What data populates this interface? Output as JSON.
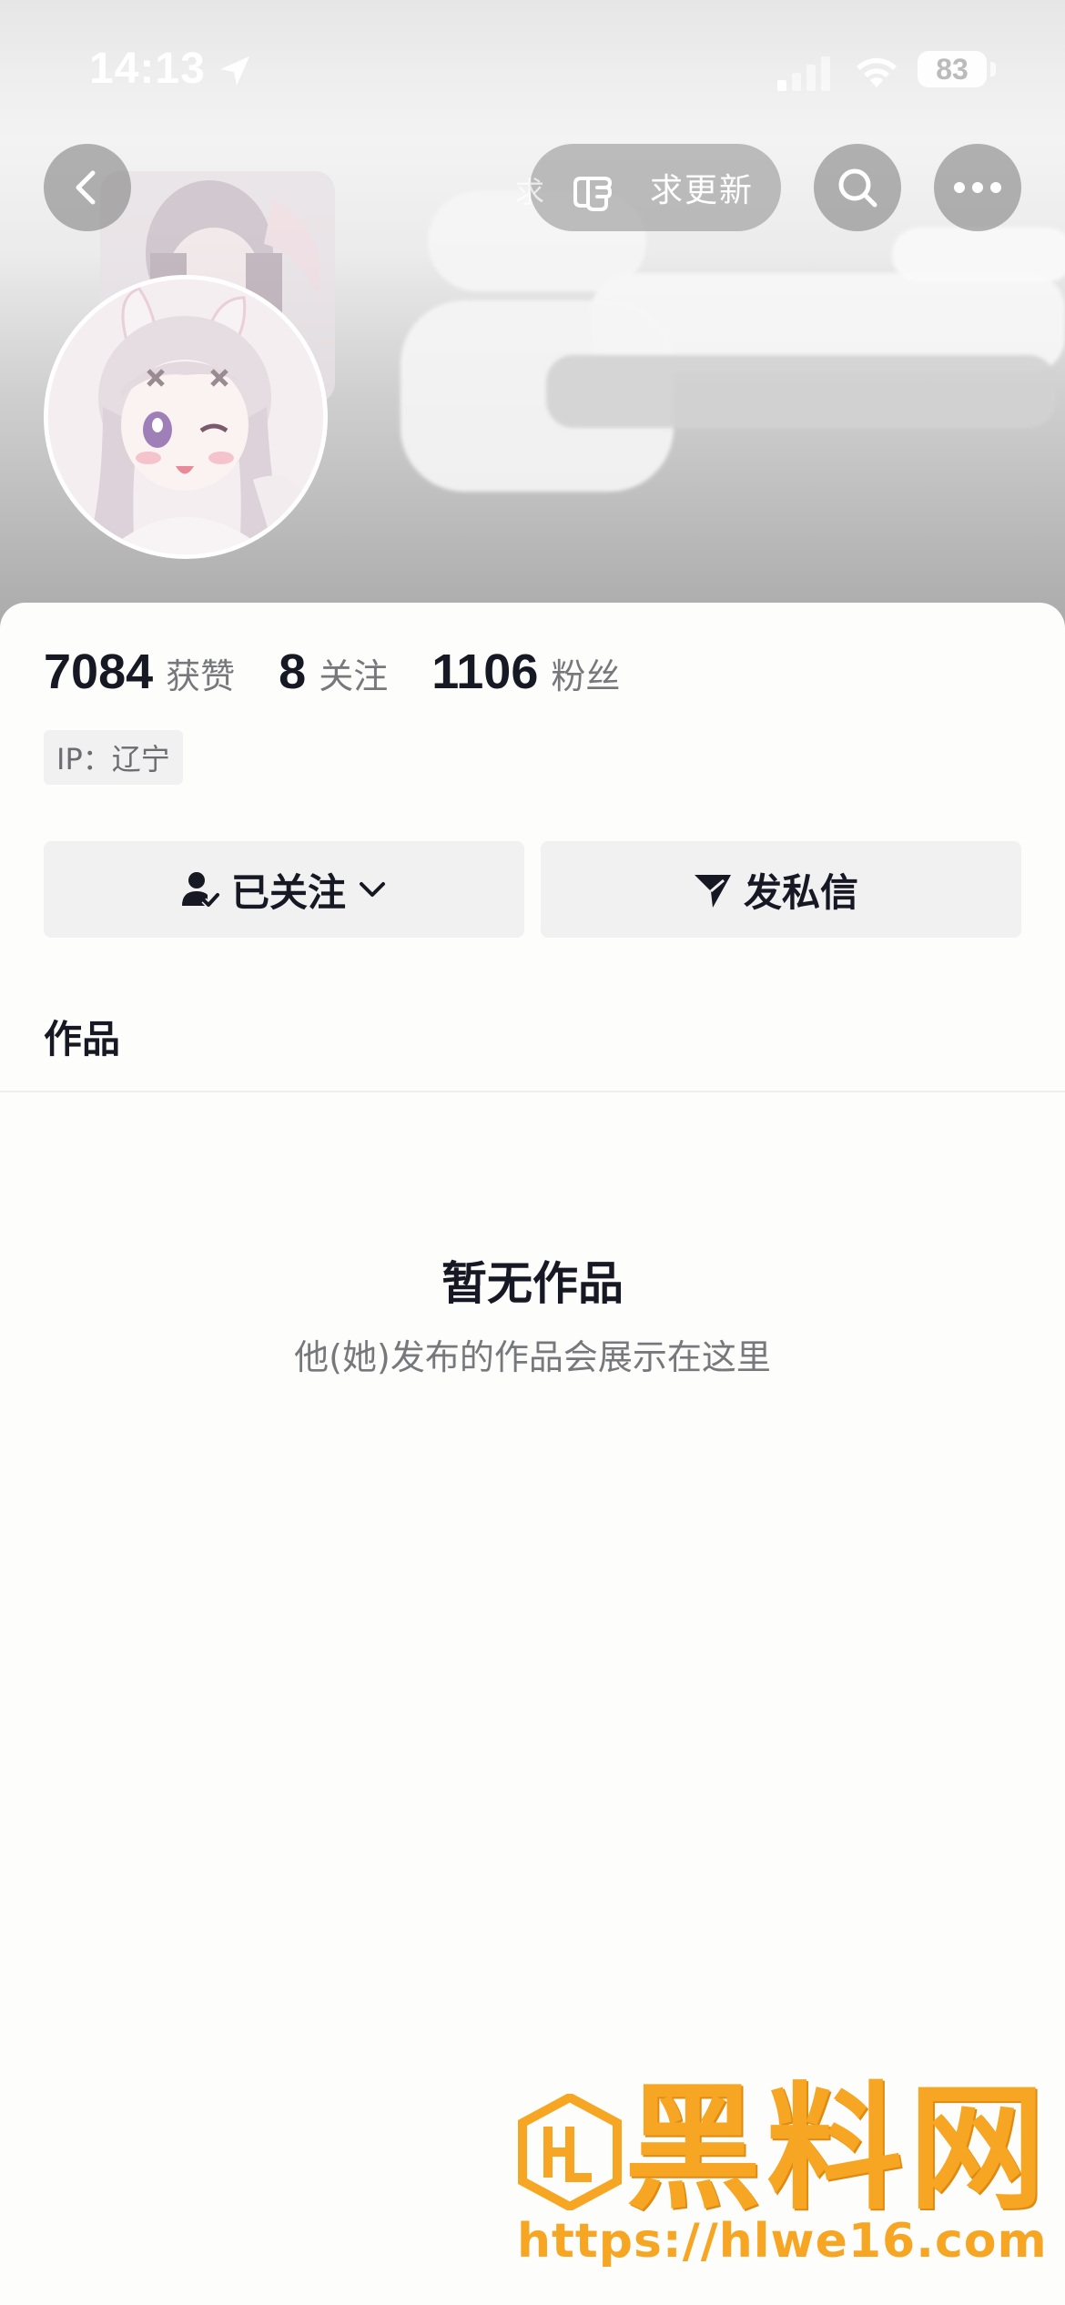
{
  "status_bar": {
    "time": "14:13",
    "battery": "83",
    "icons": [
      "location-arrow-icon",
      "signal-icon",
      "wifi-icon",
      "battery-icon"
    ]
  },
  "header": {
    "update_button_label": "求更新",
    "update_button_ghost_text": "求",
    "icons": [
      "chevron-left-icon",
      "pointing-hand-icon",
      "search-icon",
      "more-icon"
    ]
  },
  "profile": {
    "stats": [
      {
        "value": "7084",
        "label": "获赞"
      },
      {
        "value": "8",
        "label": "关注"
      },
      {
        "value": "1106",
        "label": "粉丝"
      }
    ],
    "ip": "IP：辽宁",
    "follow_button_label": "已关注",
    "message_button_label": "发私信"
  },
  "tabs": {
    "works_label": "作品"
  },
  "empty_state": {
    "title": "暂无作品",
    "subtitle": "他(她)发布的作品会展示在这里"
  },
  "watermark": {
    "title": "黑料网",
    "url": "https://hlwe16.com"
  },
  "colors": {
    "text_primary": "#161823",
    "text_secondary": "#77787c",
    "button_bg": "#f1f1f2",
    "watermark": "#f6a623"
  }
}
